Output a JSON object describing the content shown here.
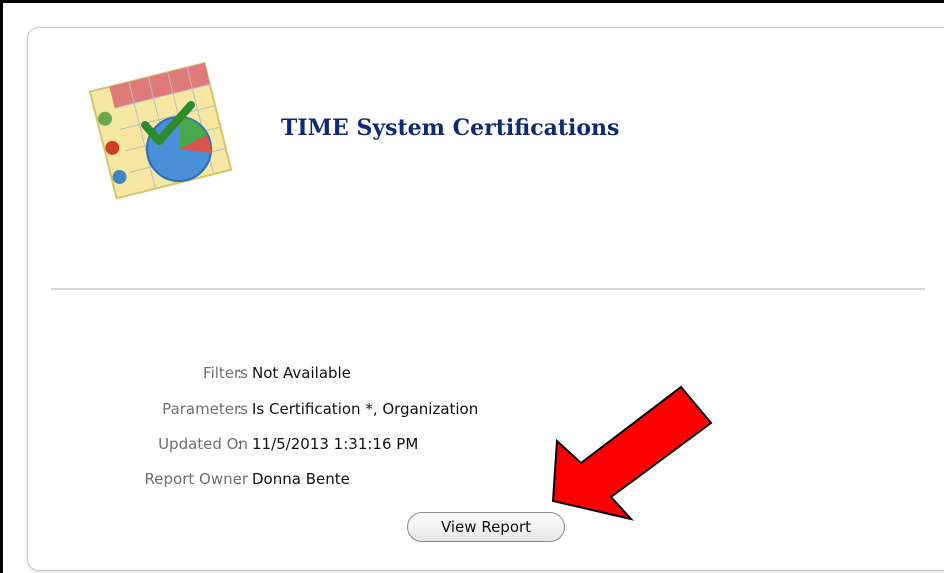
{
  "report": {
    "title": "TIME System Certifications",
    "icon": "calendar-report-icon"
  },
  "details": [
    {
      "label": "Filters",
      "value": "Not Available"
    },
    {
      "label": "Parameters",
      "value": "Is Certification *, Organization"
    },
    {
      "label": "Updated On",
      "value": "11/5/2013 1:31:16 PM"
    },
    {
      "label": "Report Owner",
      "value": "Donna Bente"
    }
  ],
  "separator": ":",
  "actions": {
    "view_report_label": "View Report"
  },
  "annotation": {
    "arrow_color": "#ff0000",
    "icon": "red-arrow-icon"
  },
  "colors": {
    "title": "#0d2a73",
    "label": "#707070"
  }
}
